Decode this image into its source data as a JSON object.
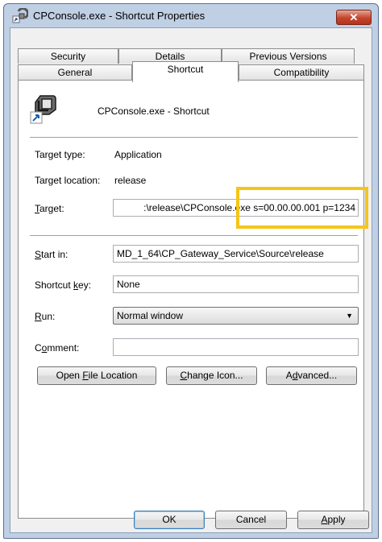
{
  "window": {
    "title": "CPConsole.exe - Shortcut Properties",
    "close_glyph": "✕"
  },
  "tabs": {
    "row1": [
      "Security",
      "Details",
      "Previous Versions"
    ],
    "row2": [
      "General",
      "Shortcut",
      "Compatibility"
    ],
    "active": "Shortcut"
  },
  "shortcut": {
    "name": "CPConsole.exe - Shortcut",
    "target_type_label": "Target type:",
    "target_type_value": "Application",
    "target_location_label": "Target location:",
    "target_location_value": "release",
    "target_label_prefix": "",
    "target_label_u": "T",
    "target_label_rest": "arget:",
    "target_value": ":\\release\\CPConsole.exe s=00.00.00.001 p=1234",
    "start_in_label_u": "S",
    "start_in_label_rest": "tart in:",
    "start_in_value": "MD_1_64\\CP_Gateway_Service\\Source\\release",
    "shortcut_key_label_pre": "Shortcut ",
    "shortcut_key_label_u": "k",
    "shortcut_key_label_rest": "ey:",
    "shortcut_key_value": "None",
    "run_label_u": "R",
    "run_label_rest": "un:",
    "run_value": "Normal window",
    "comment_label_pre": "C",
    "comment_label_u": "o",
    "comment_label_rest": "mment:",
    "comment_value": ""
  },
  "buttons": {
    "open_file_location_pre": "Open ",
    "open_file_location_u": "F",
    "open_file_location_rest": "ile Location",
    "change_icon_u": "C",
    "change_icon_rest": "hange Icon...",
    "advanced_pre": "A",
    "advanced_u": "d",
    "advanced_rest": "vanced...",
    "ok": "OK",
    "cancel": "Cancel",
    "apply_u": "A",
    "apply_rest": "pply"
  },
  "annotation": {
    "color": "#f5c518"
  }
}
